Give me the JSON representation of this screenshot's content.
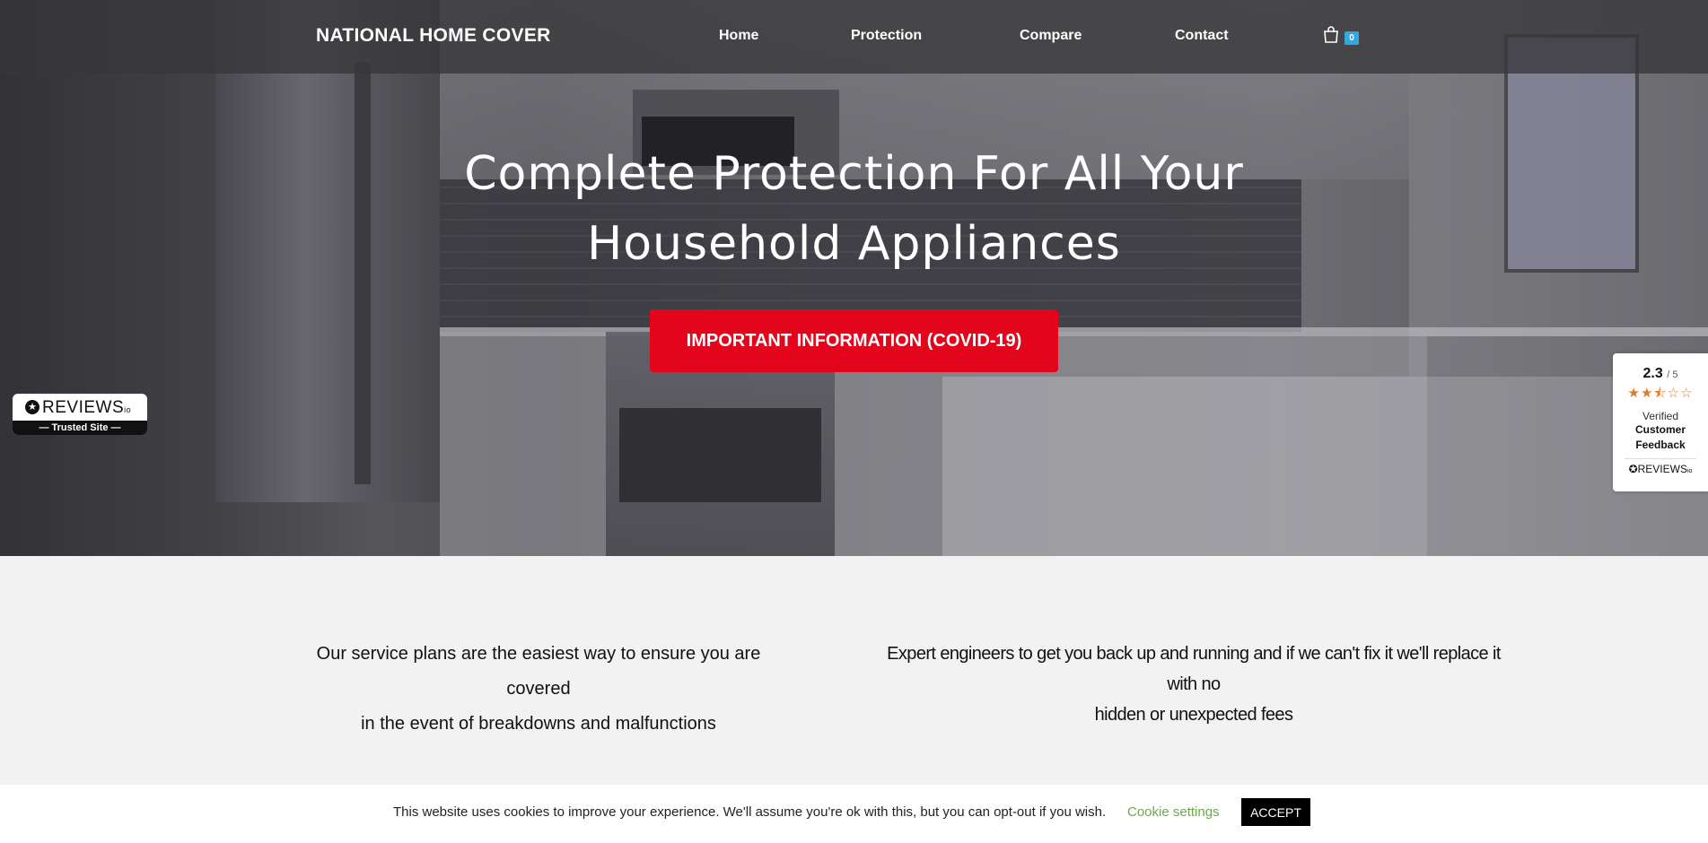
{
  "brand": {
    "name": "NATIONAL HOME COVER"
  },
  "nav": {
    "items": [
      {
        "label": "Home"
      },
      {
        "label": "Protection"
      },
      {
        "label": "Compare"
      },
      {
        "label": "Contact"
      }
    ],
    "cart_icon": "shopping-bag-icon",
    "cart_count": "0"
  },
  "hero": {
    "title_line1": "Complete Protection For All Your",
    "title_line2": "Household Appliances",
    "cta_label": "IMPORTANT INFORMATION (COVID-19)"
  },
  "trusted_badge": {
    "brand": "REVIEWS",
    "brand_suffix": "io",
    "tagline": "— Trusted Site —"
  },
  "reviews_widget": {
    "score": "2.3",
    "out_of": "/ 5",
    "stars": "★★⯪☆☆",
    "verified": "Verified",
    "customer": "Customer",
    "feedback": "Feedback",
    "brand": "REVIEWS",
    "brand_suffix": "io"
  },
  "features": {
    "one_line1": "Our service plans are the easiest way to ensure you are covered",
    "one_line2": "in the event of breakdowns and malfunctions",
    "two_line1": "Expert engineers to get you back up and running and if we can't fix it we'll replace it with no",
    "two_line2": "hidden or unexpected fees"
  },
  "cookie": {
    "message": "This website uses cookies to improve your experience. We'll assume you're ok with this, but you can opt-out if you wish.",
    "settings_label": "Cookie settings",
    "accept_label": "ACCEPT"
  },
  "colors": {
    "cta": "#e3051b",
    "cart_badge": "#33a8e0",
    "cookie_link": "#6aa84f",
    "star": "#e07b2a"
  }
}
